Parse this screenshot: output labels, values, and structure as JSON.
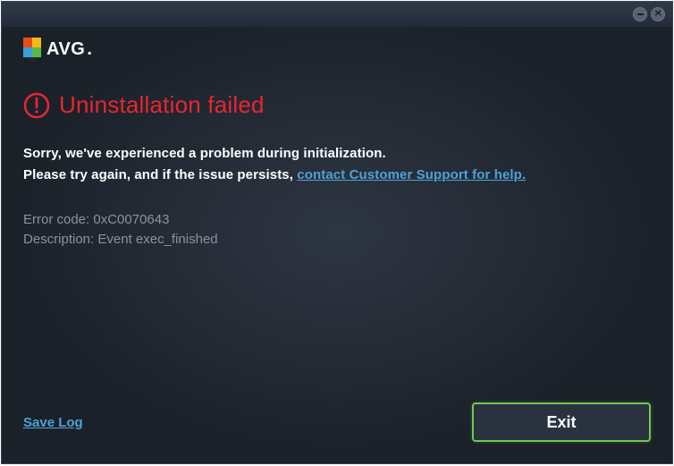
{
  "logo": {
    "text": "AVG"
  },
  "heading": "Uninstallation failed",
  "message": {
    "line1": "Sorry, we've experienced a problem during initialization.",
    "line2_prefix": "Please try again, and if the issue persists, ",
    "support_link": "contact Customer Support for help."
  },
  "error": {
    "code_label": "Error code: ",
    "code_value": "0xC0070643",
    "desc_label": "Description: ",
    "desc_value": "Event exec_finished"
  },
  "footer": {
    "save_log": "Save Log",
    "exit": "Exit"
  }
}
